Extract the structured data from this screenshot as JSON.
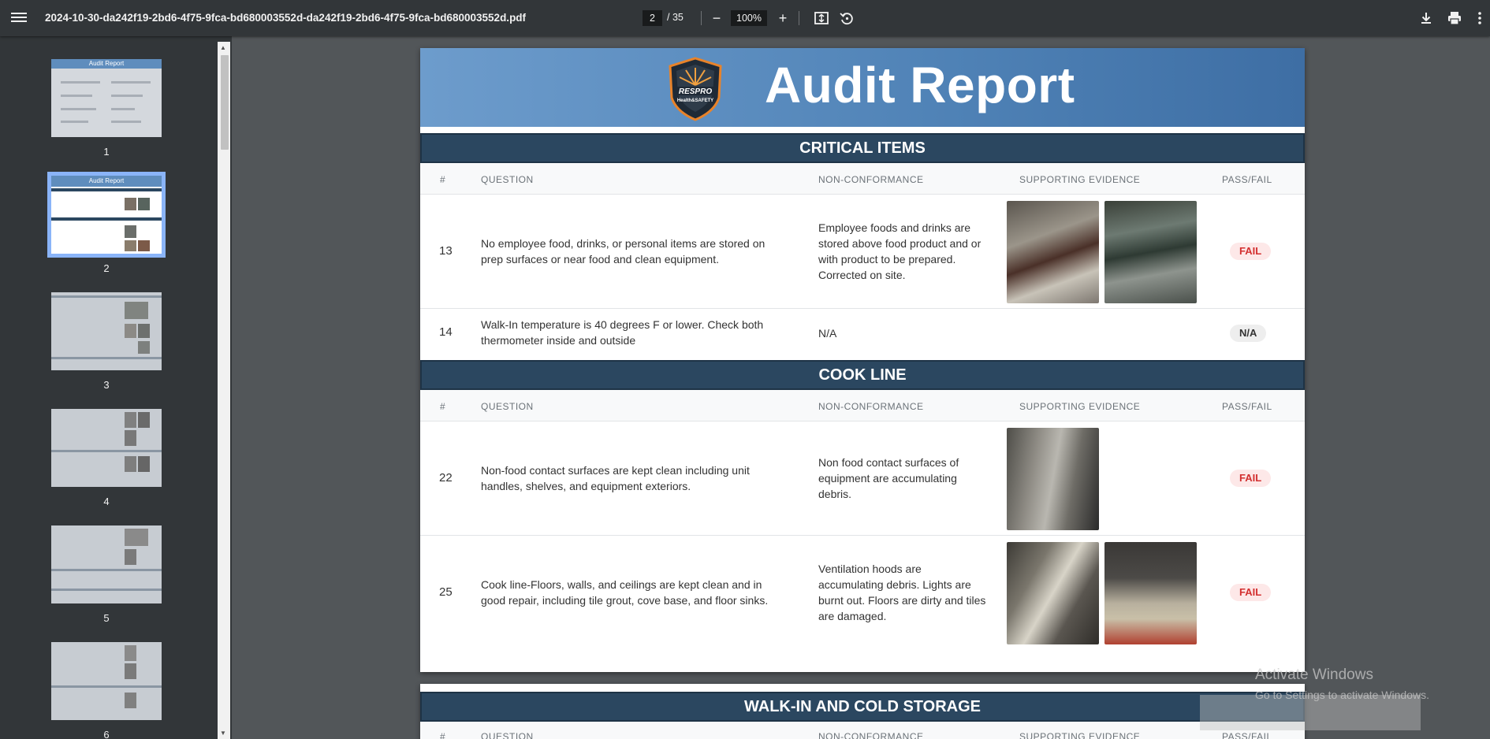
{
  "toolbar": {
    "filename": "2024-10-30-da242f19-2bd6-4f75-9fca-bd680003552d-da242f19-2bd6-4f75-9fca-bd680003552d.pdf",
    "current_page": "2",
    "total_pages": "/ 35",
    "zoom": "100%",
    "zoom_out": "−",
    "zoom_in": "+"
  },
  "sidebar": {
    "thumbnails": [
      {
        "num": "1",
        "title": "Audit Report"
      },
      {
        "num": "2",
        "title": "Audit Report"
      },
      {
        "num": "3"
      },
      {
        "num": "4"
      },
      {
        "num": "5"
      },
      {
        "num": "6"
      }
    ]
  },
  "report": {
    "title": "Audit Report",
    "logo_text_1": "RESPRO",
    "logo_text_2": "Health&SAFETY",
    "columns": {
      "num": "#",
      "question": "QUESTION",
      "nonconformance": "NON-CONFORMANCE",
      "evidence": "SUPPORTING EVIDENCE",
      "passfail": "PASS/FAIL"
    },
    "sections": [
      {
        "title": "CRITICAL ITEMS",
        "rows": [
          {
            "num": "13",
            "question": "No employee food, drinks, or personal items are stored on prep surfaces or near food and clean equipment.",
            "nonconformance": "Employee foods and drinks are stored above food product and or with product to be prepared. Corrected on site.",
            "result": "FAIL"
          },
          {
            "num": "14",
            "question": "Walk-In temperature is 40 degrees F or lower. Check both thermometer inside and outside",
            "nonconformance": "N/A",
            "result": "N/A"
          }
        ]
      },
      {
        "title": "COOK LINE",
        "rows": [
          {
            "num": "22",
            "question": "Non-food contact surfaces are kept clean including unit handles, shelves, and equipment exteriors.",
            "nonconformance": "Non food contact surfaces of equipment are accumulating debris.",
            "result": "FAIL"
          },
          {
            "num": "25",
            "question": "Cook line-Floors, walls, and ceilings are kept clean and in good repair, including tile grout, cove base, and floor sinks.",
            "nonconformance": "Ventilation hoods are accumulating debris. Lights are burnt out. Floors are dirty and tiles are damaged.",
            "result": "FAIL"
          }
        ]
      },
      {
        "title": "WALK-IN AND COLD STORAGE",
        "rows": []
      }
    ]
  },
  "watermark": {
    "line1": "Activate Windows",
    "line2": "Go to Settings to activate Windows."
  },
  "colors": {
    "toolbar_bg": "#323639",
    "section_bar": "#2b4760",
    "fail_text": "#d32f2f",
    "fail_bg": "#fde8e8",
    "active_thumb": "#8ab4f8"
  }
}
